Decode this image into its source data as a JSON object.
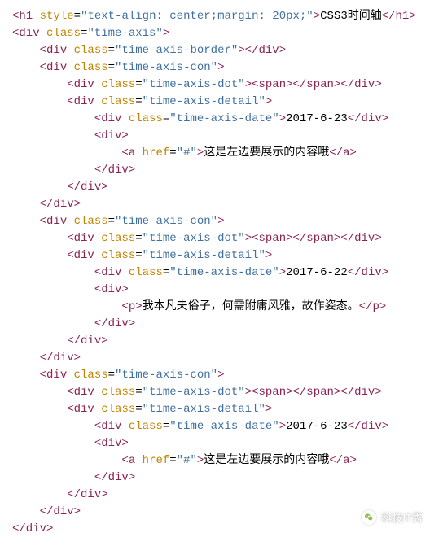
{
  "code": {
    "h1_style": "text-align: center;margin: 20px;",
    "h1_text": "CSS3时间轴",
    "cls_time_axis": "time-axis",
    "cls_border": "time-axis-border",
    "cls_con": "time-axis-con",
    "cls_dot": "time-axis-dot",
    "cls_detail": "time-axis-detail",
    "cls_date": "time-axis-date",
    "href_hash": "#",
    "items": [
      {
        "date": "2017-6-23",
        "inner_type": "a",
        "inner_text": "这是左边要展示的内容哦"
      },
      {
        "date": "2017-6-22",
        "inner_type": "p",
        "inner_text": "我本凡夫俗子，何需附庸风雅，故作姿态。"
      },
      {
        "date": "2017-6-23",
        "inner_type": "a",
        "inner_text": "这是左边要展示的内容哦"
      }
    ]
  },
  "watermark": {
    "text": "科技IT秀"
  }
}
